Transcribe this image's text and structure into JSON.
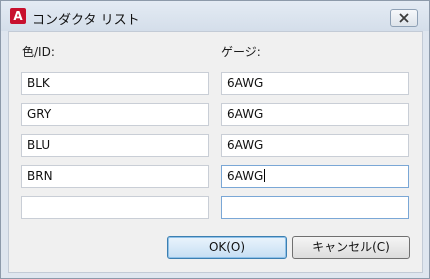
{
  "window": {
    "title": "コンダクタ リスト",
    "app_icon_letter": "A",
    "colors": {
      "title_bg": "#dbe3ee",
      "client_bg": "#f0f0f0",
      "app_icon": "#c8102e",
      "default_button": "#c6def3"
    }
  },
  "columns": {
    "color_label": "色/ID:",
    "gauge_label": "ゲージ:"
  },
  "rows": [
    {
      "color": "BLK",
      "gauge": "6AWG"
    },
    {
      "color": "GRY",
      "gauge": "6AWG"
    },
    {
      "color": "BLU",
      "gauge": "6AWG"
    },
    {
      "color": "BRN",
      "gauge": "6AWG"
    },
    {
      "color": "",
      "gauge": ""
    }
  ],
  "buttons": {
    "ok_label": "OK(O)",
    "cancel_label": "キャンセル(C)"
  }
}
